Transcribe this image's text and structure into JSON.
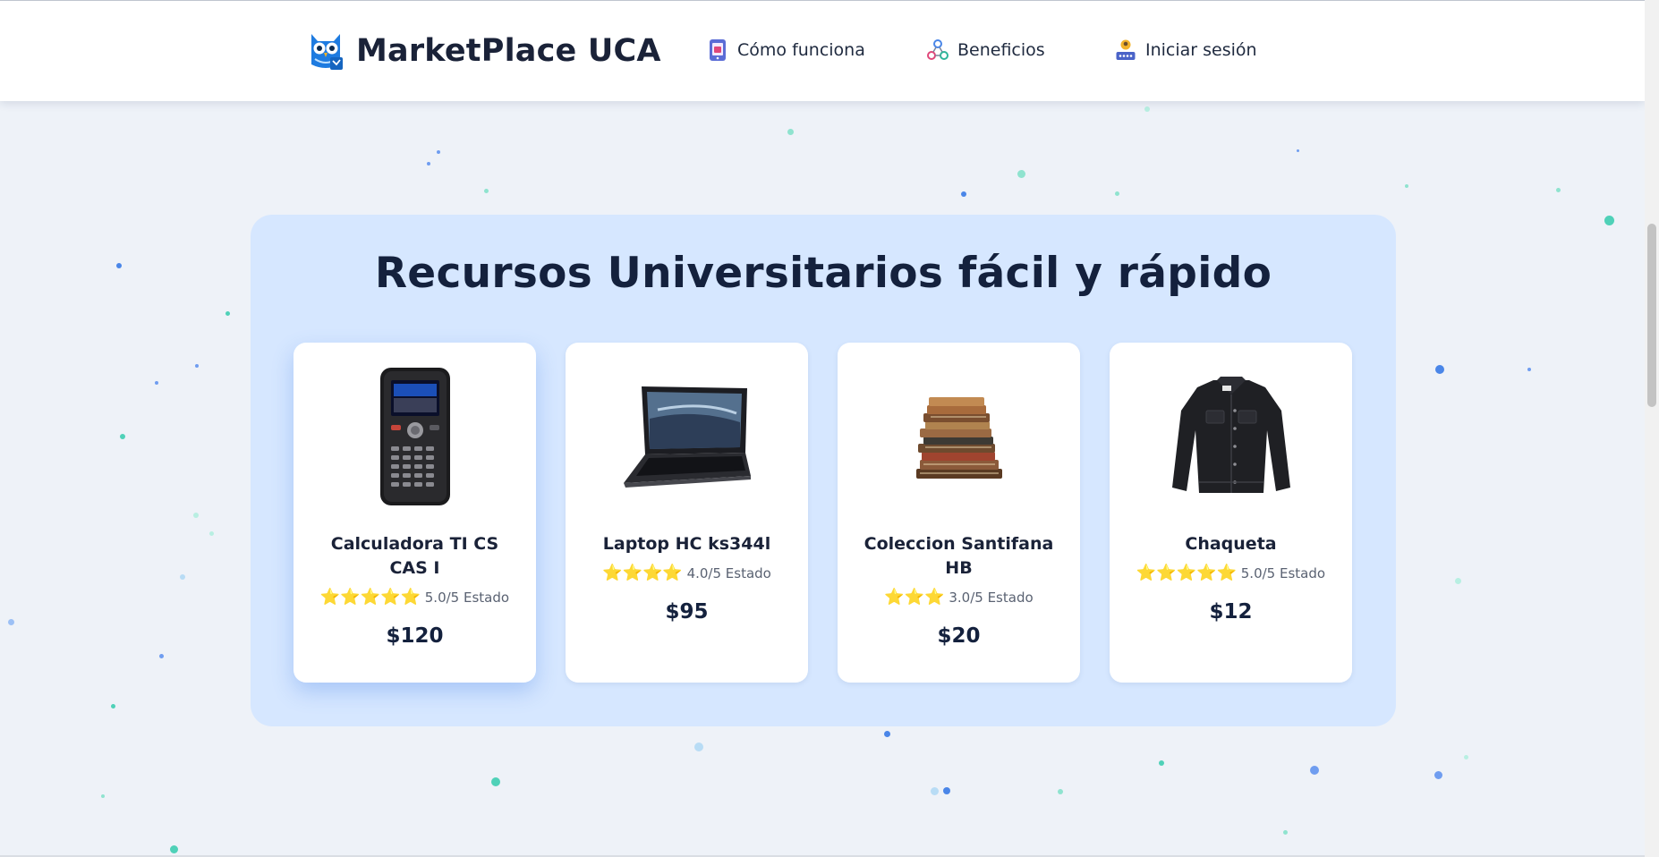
{
  "header": {
    "brand": "MarketPlace UCA",
    "nav": [
      {
        "label": "Cómo funciona",
        "icon": "phone-app-icon"
      },
      {
        "label": "Beneficios",
        "icon": "benefits-network-icon"
      },
      {
        "label": "Iniciar sesión",
        "icon": "user-login-icon"
      }
    ]
  },
  "hero": {
    "title": "Recursos Universitarios fácil y rápido"
  },
  "products": [
    {
      "name": "Calculadora TI CS CAS I",
      "stars": "⭐⭐⭐⭐⭐",
      "rating": "5.0/5 Estado",
      "price": "$120",
      "image": "graphing-calculator"
    },
    {
      "name": "Laptop HC ks344l",
      "stars": "⭐⭐⭐⭐",
      "rating": "4.0/5 Estado",
      "price": "$95",
      "image": "laptop"
    },
    {
      "name": "Coleccion Santifana HB",
      "stars": "⭐⭐⭐",
      "rating": "3.0/5 Estado",
      "price": "$20",
      "image": "book-stack"
    },
    {
      "name": "Chaqueta",
      "stars": "⭐⭐⭐⭐⭐",
      "rating": "5.0/5 Estado",
      "price": "$12",
      "image": "denim-jacket"
    }
  ],
  "colors": {
    "panel": "#d6e7ff",
    "star": "#f5c400",
    "background": "#eef2f8",
    "brand_blue": "#1e7be0"
  }
}
